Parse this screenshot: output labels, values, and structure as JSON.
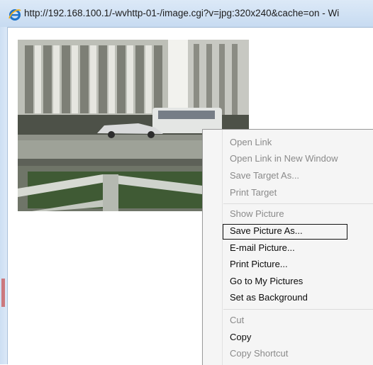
{
  "window": {
    "title": "http://192.168.100.1/-wvhttp-01-/image.cgi?v=jpg:320x240&cache=on - Wi"
  },
  "icons": {
    "browser": "internet-explorer-icon"
  },
  "content": {
    "image_alt": "camera-snapshot"
  },
  "context_menu": {
    "items": [
      {
        "label": "Open Link",
        "enabled": false
      },
      {
        "label": "Open Link in New Window",
        "enabled": false
      },
      {
        "label": "Save Target As...",
        "enabled": false
      },
      {
        "label": "Print Target",
        "enabled": false
      },
      {
        "label": "Show Picture",
        "enabled": false
      },
      {
        "label": "Save Picture As...",
        "enabled": true,
        "highlighted": true
      },
      {
        "label": "E-mail Picture...",
        "enabled": true
      },
      {
        "label": "Print Picture...",
        "enabled": true
      },
      {
        "label": "Go to My Pictures",
        "enabled": true
      },
      {
        "label": "Set as Background",
        "enabled": true
      },
      {
        "label": "Cut",
        "enabled": false
      },
      {
        "label": "Copy",
        "enabled": true
      },
      {
        "label": "Copy Shortcut",
        "enabled": false
      }
    ]
  }
}
